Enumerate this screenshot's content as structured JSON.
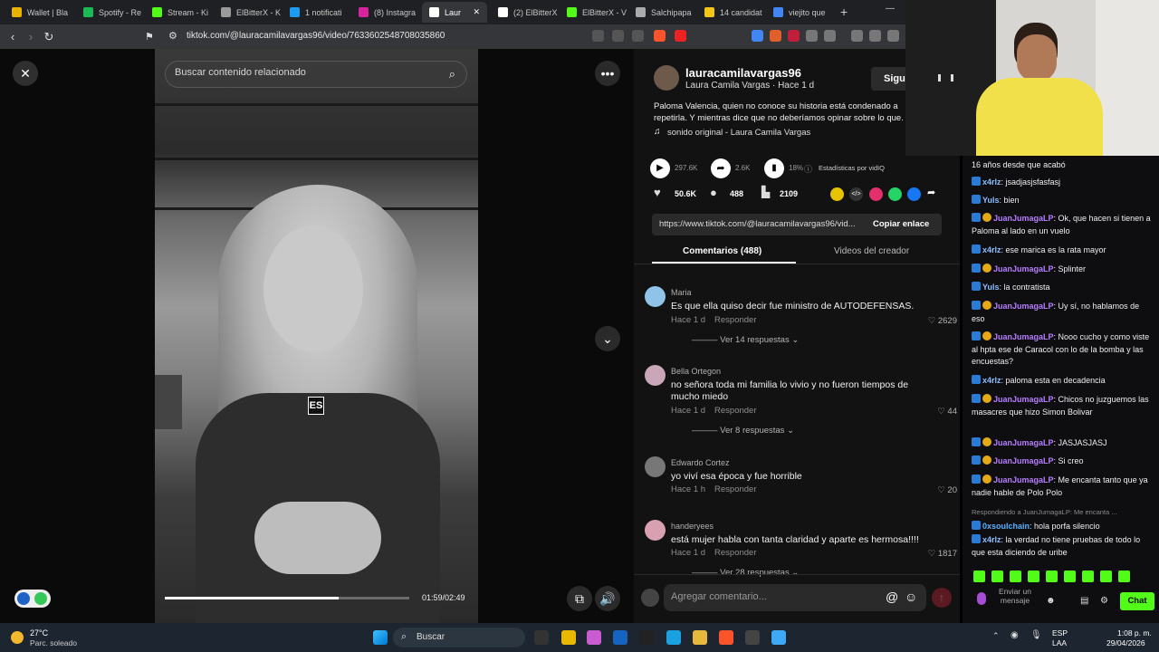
{
  "tabs": [
    {
      "label": "Wallet | Bla",
      "color": "#e8b400"
    },
    {
      "label": "Spotify - Re",
      "color": "#1db954"
    },
    {
      "label": "Stream - Ki",
      "color": "#53fc18"
    },
    {
      "label": "ElBitterX - K",
      "color": "#9a9a9a"
    },
    {
      "label": "1 notificati",
      "color": "#1d9bf0"
    },
    {
      "label": "(8) Instagra",
      "color": "#d6249f"
    },
    {
      "label": "Laur",
      "color": "#ffffff"
    },
    {
      "label": "(2) ElBitterX",
      "color": "#ffffff"
    },
    {
      "label": "ElBitterX - V",
      "color": "#53fc18"
    },
    {
      "label": "Salchipapa",
      "color": "#aaaaaa"
    },
    {
      "label": "14 candidat",
      "color": "#f5c518"
    },
    {
      "label": "viejito que",
      "color": "#4285f4"
    }
  ],
  "url": "tiktok.com/@lauracamilavargas96/video/7633602548708035860",
  "video": {
    "search_placeholder": "Buscar contenido relacionado",
    "badge": "ES",
    "timecode": "01:59/02:49",
    "progress": 0.71
  },
  "post": {
    "username": "lauracamilavargas96",
    "display": "Laura Camila Vargas · Hace 1 d",
    "follow": "Sigui",
    "caption": "Paloma Valencia, quien no conoce su historia está condenado a repetirla. Y mientras dice que no deberíamos opinar sobre lo que.",
    "sound": "sonido original - Laura Camila Vargas",
    "plays": "297.6K",
    "shares_count": "2.6K",
    "vidiq_pct": "18%",
    "vidiq_label": "Estadísticas por vidIQ",
    "likes": "50.6K",
    "comments": "488",
    "saves": "2109",
    "link": "https://www.tiktok.com/@lauracamilavargas96/vid...",
    "copy": "Copiar enlace",
    "tab_comments": "Comentarios (488)",
    "tab_videos": "Videos del creador",
    "add_comment": "Agregar comentario..."
  },
  "comments": [
    {
      "name": "Maria",
      "text": "Es que ella quiso decir fue ministro de AUTODEFENSAS.",
      "time": "Hace 1 d",
      "reply": "Responder",
      "likes": "2629",
      "more": "Ver 14 respuestas",
      "color": "#8fc3e8"
    },
    {
      "name": "Bella Ortegon",
      "text": "no señora toda mi familia lo vivio y no fueron tiempos de mucho miedo",
      "time": "Hace 1 d",
      "reply": "Responder",
      "likes": "44",
      "more": "Ver 8 respuestas",
      "color": "#c9a6b8"
    },
    {
      "name": "Edwardo Cortez",
      "text": "yo viví esa época y fue horrible",
      "time": "Hace 1 h",
      "reply": "Responder",
      "likes": "20",
      "more": "",
      "color": "#777777"
    },
    {
      "name": "handeryees",
      "text": "está mujer habla con tanta claridad y aparte es hermosa!!!!",
      "time": "Hace 1 d",
      "reply": "Responder",
      "likes": "1817",
      "more": "Ver 28 respuestas",
      "color": "#d8a0b0"
    }
  ],
  "chat": [
    {
      "user": "",
      "text": "16 años desde que acabó",
      "cls": ""
    },
    {
      "user": "x4rlz",
      "text": ": jsadjasjsfasfasj",
      "cls": "u4"
    },
    {
      "user": "Yuls",
      "text": ": bien",
      "cls": "u4"
    },
    {
      "user": "JuanJumagaLP",
      "text": ": Ok, que hacen si tienen a Paloma al lado en un vuelo",
      "cls": "u2"
    },
    {
      "user": "x4rlz",
      "text": ": ese marica es la rata mayor",
      "cls": "u4"
    },
    {
      "user": "JuanJumagaLP",
      "text": ": Splinter",
      "cls": "u2"
    },
    {
      "user": "Yuls",
      "text": ": la contratista",
      "cls": "u4"
    },
    {
      "user": "JuanJumagaLP",
      "text": ": Uy sí, no hablamos de eso",
      "cls": "u2"
    },
    {
      "user": "JuanJumagaLP",
      "text": ": Nooo cucho y como viste al hpta ese de Caracol con lo de la bomba y las encuestas?",
      "cls": "u2"
    },
    {
      "user": "x4rlz",
      "text": ": paloma esta en decadencia",
      "cls": "u4"
    },
    {
      "user": "JuanJumagaLP",
      "text": ": Chicos no juzguemos las masacres que hizo Simon Bolivar",
      "cls": "u2"
    },
    {
      "user": "JuanJumagaLP",
      "text": ": JASJASJASJ",
      "cls": "u2"
    },
    {
      "user": "JuanJumagaLP",
      "text": ": Si creo",
      "cls": "u2"
    },
    {
      "user": "JuanJumagaLP",
      "text": ": Me encanta tanto que ya nadie hable de Polo Polo",
      "cls": "u2"
    },
    {
      "user": "0xsoulchain",
      "text": ": hola porfa silencio",
      "cls": "u3"
    },
    {
      "user": "x4rlz",
      "text": ": la verdad no tiene pruebas de todo lo que esta diciendo de uribe",
      "cls": "u4"
    }
  ],
  "chat_reply_hint": "Respondiendo a JuanJumagaLP: Me encanta ...",
  "chat_input": "Enviar un mensaje",
  "chat_button": "Chat",
  "taskbar": {
    "temp": "27°C",
    "weather": "Parc. soleado",
    "search": "Buscar",
    "lang1": "ESP",
    "lang2": "LAA",
    "time": "1:08 p. m.",
    "date": "29/04/2026"
  }
}
